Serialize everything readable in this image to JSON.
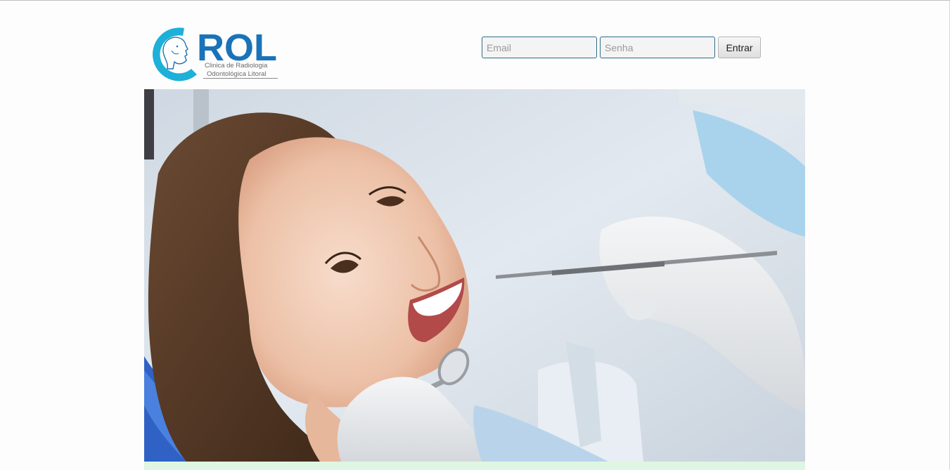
{
  "logo": {
    "brand": "ROL",
    "subtitle_line1": "Clinica de Radiologia",
    "subtitle_line2": "Odontológica Litoral",
    "colors": {
      "brand_blue": "#1a73b8",
      "cyan": "#1db0d8"
    }
  },
  "login": {
    "email_placeholder": "Email",
    "senha_placeholder": "Senha",
    "submit_label": "Entrar",
    "field_border_color": "#2a6f85"
  },
  "hero": {
    "image_subject": "dental-patient-photo"
  }
}
